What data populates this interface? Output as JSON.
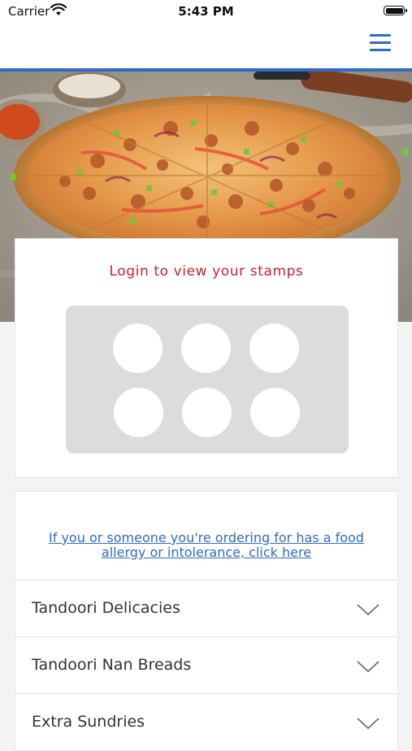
{
  "status": {
    "carrier": "Carrier",
    "time": "5:43 PM"
  },
  "nav": {
    "menu_icon": "hamburger-menu-icon"
  },
  "hero": {
    "image": "pizza-hero-image"
  },
  "stamps": {
    "title": "Login to view your stamps",
    "count": 6,
    "filled": 0
  },
  "menu": {
    "allergy_line1": "If you or someone you're ordering for has a food",
    "allergy_line2": "allergy or intolerance, click here",
    "categories": [
      {
        "label": "Tandoori Delicacies"
      },
      {
        "label": "Tandoori Nan Breads"
      },
      {
        "label": "Extra Sundries"
      }
    ]
  },
  "colors": {
    "accent": "#2f6bc4",
    "title_red": "#c8212a"
  }
}
